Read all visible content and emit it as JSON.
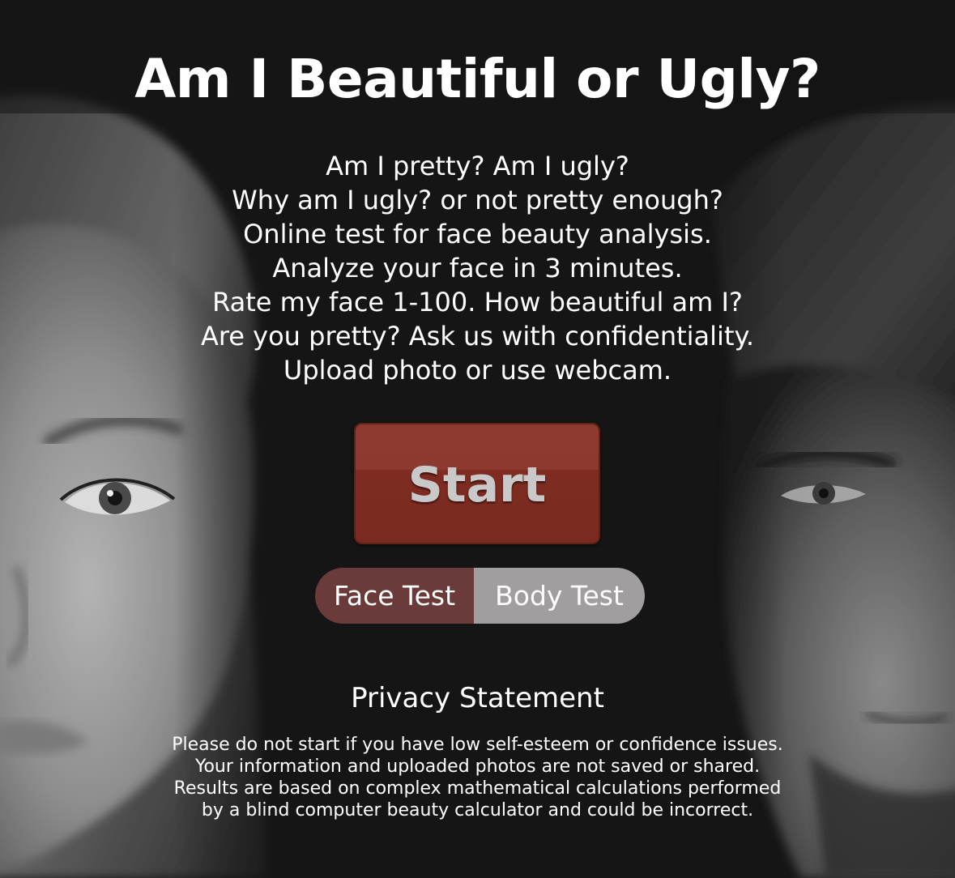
{
  "page": {
    "title": "Am I Beautiful or Ugly?",
    "intro_lines": [
      "Am I pretty? Am I ugly?",
      "Why am I ugly? or not pretty enough?",
      "Online test for face beauty analysis.",
      "Analyze your face in 3 minutes.",
      "Rate my face 1-100. How beautiful am I?",
      "Are you pretty? Ask us with confidentiality.",
      "Upload photo or use webcam."
    ],
    "start_button": "Start",
    "test_toggle": {
      "options": [
        "Face Test",
        "Body Test"
      ],
      "selected": "Face Test"
    },
    "privacy": {
      "title": "Privacy Statement",
      "lines": [
        "Please do not start if you have low self-esteem or confidence issues.",
        "Your information and uploaded photos are not saved or shared.",
        "Results are based on complex mathematical calculations performed",
        "by a blind computer beauty calculator and could be incorrect."
      ]
    }
  },
  "colors": {
    "background": "#151515",
    "start_button": "#7e2c21",
    "toggle_selected": "#6b3a3a",
    "toggle_unselected": "#a19e9f",
    "text": "#ffffff"
  },
  "images": {
    "left": "woman-face-photo",
    "right": "man-face-photo"
  }
}
